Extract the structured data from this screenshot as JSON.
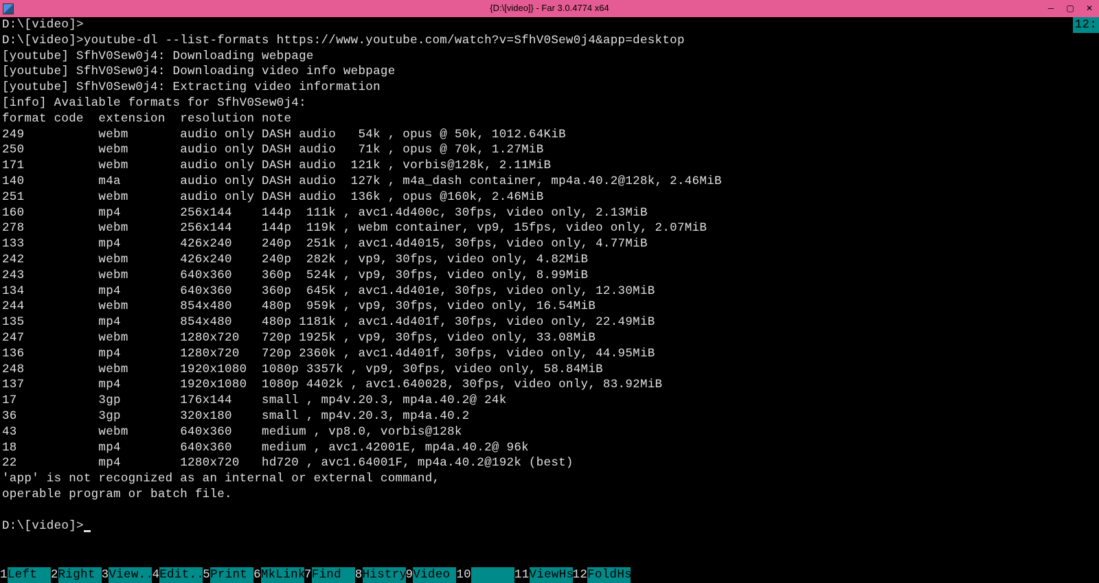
{
  "titlebar": {
    "text": "{D:\\[video]} - Far 3.0.4774 x64"
  },
  "corner_label": "12:",
  "terminal_lines": [
    "D:\\[video]>",
    "D:\\[video]>youtube-dl --list-formats https://www.youtube.com/watch?v=SfhV0Sew0j4&app=desktop",
    "[youtube] SfhV0Sew0j4: Downloading webpage",
    "[youtube] SfhV0Sew0j4: Downloading video info webpage",
    "[youtube] SfhV0Sew0j4: Extracting video information",
    "[info] Available formats for SfhV0Sew0j4:",
    "format code  extension  resolution note",
    "249          webm       audio only DASH audio   54k , opus @ 50k, 1012.64KiB",
    "250          webm       audio only DASH audio   71k , opus @ 70k, 1.27MiB",
    "171          webm       audio only DASH audio  121k , vorbis@128k, 2.11MiB",
    "140          m4a        audio only DASH audio  127k , m4a_dash container, mp4a.40.2@128k, 2.46MiB",
    "251          webm       audio only DASH audio  136k , opus @160k, 2.46MiB",
    "160          mp4        256x144    144p  111k , avc1.4d400c, 30fps, video only, 2.13MiB",
    "278          webm       256x144    144p  119k , webm container, vp9, 15fps, video only, 2.07MiB",
    "133          mp4        426x240    240p  251k , avc1.4d4015, 30fps, video only, 4.77MiB",
    "242          webm       426x240    240p  282k , vp9, 30fps, video only, 4.82MiB",
    "243          webm       640x360    360p  524k , vp9, 30fps, video only, 8.99MiB",
    "134          mp4        640x360    360p  645k , avc1.4d401e, 30fps, video only, 12.30MiB",
    "244          webm       854x480    480p  959k , vp9, 30fps, video only, 16.54MiB",
    "135          mp4        854x480    480p 1181k , avc1.4d401f, 30fps, video only, 22.49MiB",
    "247          webm       1280x720   720p 1925k , vp9, 30fps, video only, 33.08MiB",
    "136          mp4        1280x720   720p 2360k , avc1.4d401f, 30fps, video only, 44.95MiB",
    "248          webm       1920x1080  1080p 3357k , vp9, 30fps, video only, 58.84MiB",
    "137          mp4        1920x1080  1080p 4402k , avc1.640028, 30fps, video only, 83.92MiB",
    "17           3gp        176x144    small , mp4v.20.3, mp4a.40.2@ 24k",
    "36           3gp        320x180    small , mp4v.20.3, mp4a.40.2",
    "43           webm       640x360    medium , vp8.0, vorbis@128k",
    "18           mp4        640x360    medium , avc1.42001E, mp4a.40.2@ 96k",
    "22           mp4        1280x720   hd720 , avc1.64001F, mp4a.40.2@192k (best)",
    "'app' is not recognized as an internal or external command,",
    "operable program or batch file.",
    "",
    "D:\\[video]>"
  ],
  "fkeys": [
    {
      "num": "1",
      "label": "Left  "
    },
    {
      "num": "2",
      "label": "Right "
    },
    {
      "num": "3",
      "label": "View.."
    },
    {
      "num": "4",
      "label": "Edit.."
    },
    {
      "num": "5",
      "label": "Print "
    },
    {
      "num": "6",
      "label": "MkLink"
    },
    {
      "num": "7",
      "label": "Find  "
    },
    {
      "num": "8",
      "label": "Histry"
    },
    {
      "num": "9",
      "label": "Video "
    },
    {
      "num": "10",
      "label": "      "
    },
    {
      "num": "11",
      "label": "ViewHs"
    },
    {
      "num": "12",
      "label": "FoldHs"
    }
  ]
}
